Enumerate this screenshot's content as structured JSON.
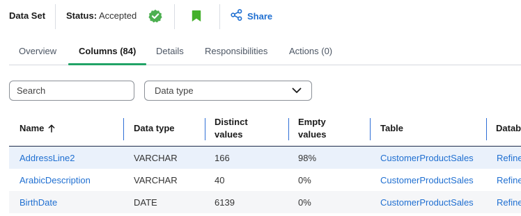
{
  "header": {
    "dataset_label": "Data Set",
    "status_prefix": "Status:",
    "status_value": "Accepted",
    "share_label": "Share"
  },
  "tabs": [
    {
      "label": "Overview"
    },
    {
      "label": "Columns (84)"
    },
    {
      "label": "Details"
    },
    {
      "label": "Responsibilities"
    },
    {
      "label": "Actions (0)"
    }
  ],
  "active_tab": "Columns (84)",
  "filters": {
    "search_placeholder": "Search",
    "data_type_placeholder": "Data type"
  },
  "table": {
    "columns": {
      "name": "Name",
      "data_type": "Data type",
      "distinct_line1": "Distinct",
      "distinct_line2": "values",
      "empty_line1": "Empty",
      "empty_line2": "values",
      "table": "Table",
      "database": "Datab"
    },
    "sort": {
      "column": "Name",
      "direction": "ascending"
    },
    "rows": [
      {
        "name": "AddressLine2",
        "data_type": "VARCHAR",
        "distinct": "166",
        "empty": "98%",
        "table": "CustomerProductSales",
        "database": "Refine"
      },
      {
        "name": "ArabicDescription",
        "data_type": "VARCHAR",
        "distinct": "40",
        "empty": "0%",
        "table": "CustomerProductSales",
        "database": "Refine"
      },
      {
        "name": "BirthDate",
        "data_type": "DATE",
        "distinct": "6139",
        "empty": "0%",
        "table": "CustomerProductSales",
        "database": "Refine"
      }
    ]
  },
  "colors": {
    "accent_green": "#21a366",
    "link_blue": "#1f6fd1",
    "status_badge": "#4caf50",
    "bookmark": "#43b02a",
    "header_divider": "#2f6fd6",
    "selected_row": "#eaf1fb"
  },
  "icons": {
    "status": "verified-check-icon",
    "bookmark": "bookmark-icon",
    "share": "share-icon",
    "sort": "arrow-up-icon",
    "dropdown": "chevron-down-icon"
  }
}
